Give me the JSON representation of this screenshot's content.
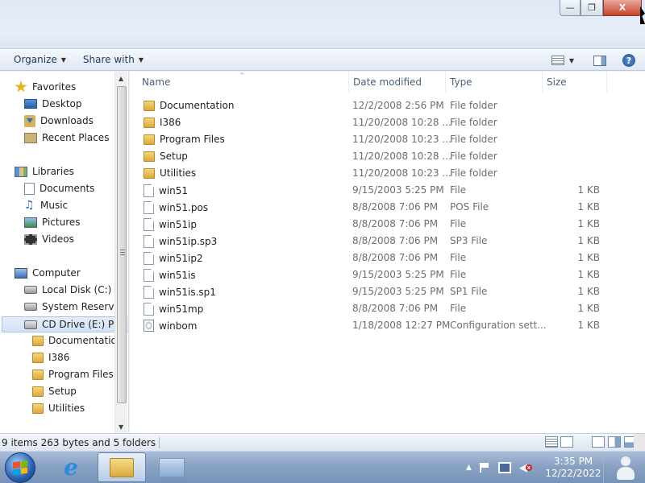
{
  "window": {
    "minimize_glyph": "—",
    "maximize_glyph": "❐",
    "close_glyph": "X"
  },
  "toolbar": {
    "organize_label": "Organize",
    "share_label": "Share with",
    "arrow_glyph": "▼",
    "help_glyph": "?"
  },
  "nav": {
    "items": [
      {
        "label": "Favorites",
        "icon": "star-icon"
      },
      {
        "label": "Desktop",
        "icon": "desktop-icon"
      },
      {
        "label": "Downloads",
        "icon": "downloads-icon"
      },
      {
        "label": "Recent Places",
        "icon": "recent-places-icon"
      },
      {
        "label": "Libraries",
        "icon": "libraries-icon"
      },
      {
        "label": "Documents",
        "icon": "documents-icon"
      },
      {
        "label": "Music",
        "icon": "music-icon"
      },
      {
        "label": "Pictures",
        "icon": "pictures-icon"
      },
      {
        "label": "Videos",
        "icon": "videos-icon"
      },
      {
        "label": "Computer",
        "icon": "computer-icon"
      },
      {
        "label": "Local Disk (C:)",
        "icon": "disk-icon"
      },
      {
        "label": "System Reserved",
        "icon": "disk-icon"
      },
      {
        "label": "CD Drive (E:) POS",
        "icon": "cd-drive-icon",
        "selected": true
      },
      {
        "label": "Documentation",
        "icon": "folder-icon"
      },
      {
        "label": "I386",
        "icon": "folder-icon"
      },
      {
        "label": "Program Files",
        "icon": "folder-icon"
      },
      {
        "label": "Setup",
        "icon": "folder-icon"
      },
      {
        "label": "Utilities",
        "icon": "folder-icon"
      }
    ]
  },
  "columns": {
    "name": "Name",
    "date": "Date modified",
    "type": "Type",
    "size": "Size",
    "sort_glyph": "^"
  },
  "files": [
    {
      "name": "Documentation",
      "date": "12/2/2008 2:56 PM",
      "type": "File folder",
      "size": "",
      "icon": "folder-icon"
    },
    {
      "name": "I386",
      "date": "11/20/2008 10:28 ...",
      "type": "File folder",
      "size": "",
      "icon": "folder-icon"
    },
    {
      "name": "Program Files",
      "date": "11/20/2008 10:23 ...",
      "type": "File folder",
      "size": "",
      "icon": "folder-icon"
    },
    {
      "name": "Setup",
      "date": "11/20/2008 10:28 ...",
      "type": "File folder",
      "size": "",
      "icon": "folder-icon"
    },
    {
      "name": "Utilities",
      "date": "11/20/2008 10:23 ...",
      "type": "File folder",
      "size": "",
      "icon": "folder-icon"
    },
    {
      "name": "win51",
      "date": "9/15/2003 5:25 PM",
      "type": "File",
      "size": "1 KB",
      "icon": "file-icon"
    },
    {
      "name": "win51.pos",
      "date": "8/8/2008 7:06 PM",
      "type": "POS File",
      "size": "1 KB",
      "icon": "file-icon"
    },
    {
      "name": "win51ip",
      "date": "8/8/2008 7:06 PM",
      "type": "File",
      "size": "1 KB",
      "icon": "file-icon"
    },
    {
      "name": "win51ip.sp3",
      "date": "8/8/2008 7:06 PM",
      "type": "SP3 File",
      "size": "1 KB",
      "icon": "file-icon"
    },
    {
      "name": "win51ip2",
      "date": "8/8/2008 7:06 PM",
      "type": "File",
      "size": "1 KB",
      "icon": "file-icon"
    },
    {
      "name": "win51is",
      "date": "9/15/2003 5:25 PM",
      "type": "File",
      "size": "1 KB",
      "icon": "file-icon"
    },
    {
      "name": "win51is.sp1",
      "date": "9/15/2003 5:25 PM",
      "type": "SP1 File",
      "size": "1 KB",
      "icon": "file-icon"
    },
    {
      "name": "win51mp",
      "date": "8/8/2008 7:06 PM",
      "type": "File",
      "size": "1 KB",
      "icon": "file-icon"
    },
    {
      "name": "winbom",
      "date": "1/18/2008 12:27 PM",
      "type": "Configuration sett...",
      "size": "1 KB",
      "icon": "config-file-icon"
    }
  ],
  "status": {
    "text": "9 items 263 bytes and 5 folders"
  },
  "taskbar": {
    "ie_glyph": "e",
    "clock_time": "3:35 PM",
    "clock_date": "12/22/2022",
    "tray_arrow": "▲",
    "volume_glyph": "◀",
    "mute_glyph": "x"
  },
  "colors": {
    "flag_red": "#f25022",
    "flag_green": "#7fba00",
    "flag_blue": "#00a4ef",
    "flag_yellow": "#ffb900"
  }
}
